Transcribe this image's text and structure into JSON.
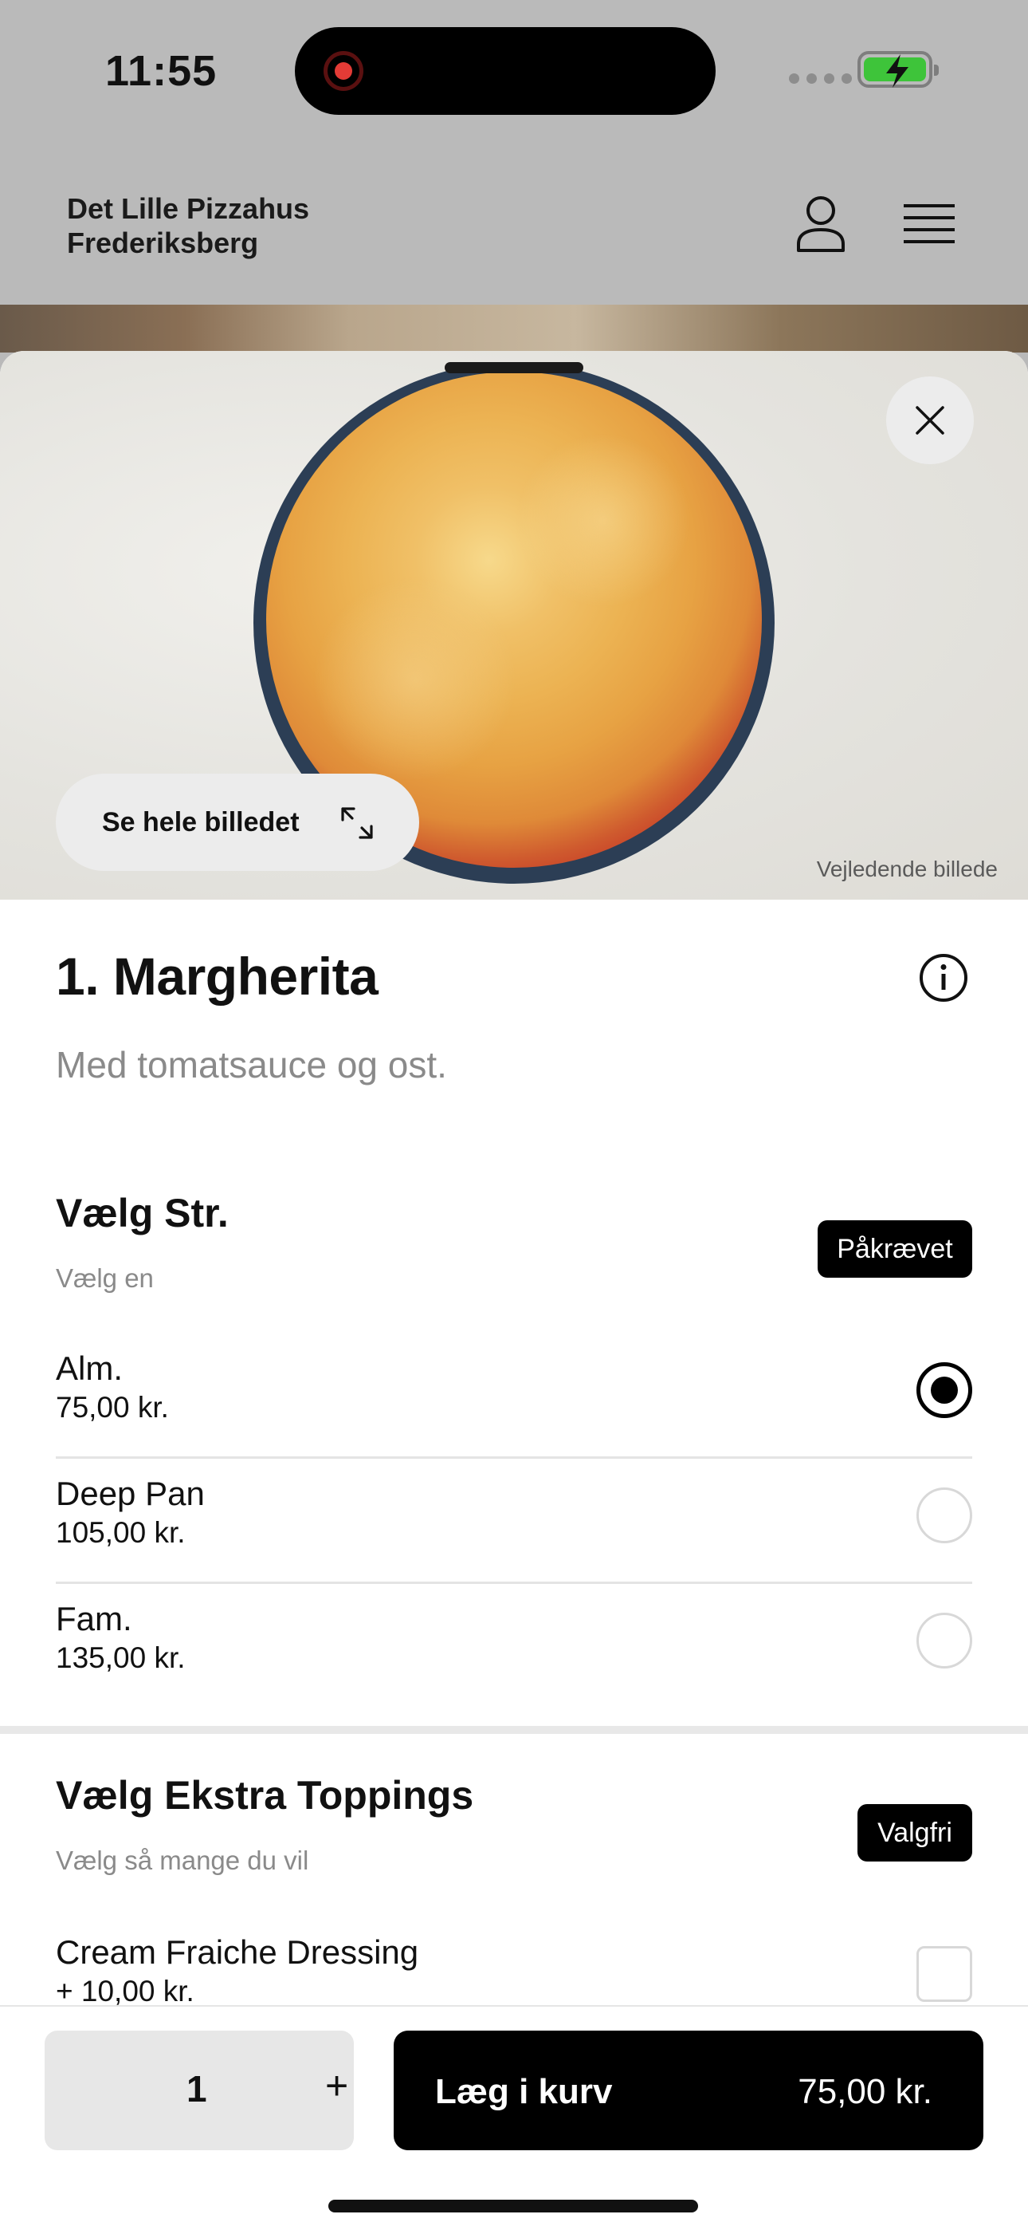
{
  "status_bar": {
    "time": "11:55",
    "battery_color": "#3ec43a"
  },
  "header": {
    "shop_name_line1": "Det Lille Pizzahus",
    "shop_name_line2": "Frederiksberg",
    "user_icon": "user-icon",
    "menu_icon": "hamburger-menu-icon"
  },
  "modal": {
    "close_icon": "close-icon",
    "see_full_image_label": "Se hele billedet",
    "expand_icon": "expand-icon",
    "image_disclaimer": "Vejledende billede"
  },
  "product": {
    "title": "1. Margherita",
    "description": "Med tomatsauce og ost.",
    "info_icon": "info-icon"
  },
  "size_section": {
    "title": "Vælg Str.",
    "subtitle": "Vælg en",
    "badge": "Påkrævet",
    "options": [
      {
        "name": "Alm.",
        "price": "75,00 kr.",
        "selected": true
      },
      {
        "name": "Deep Pan",
        "price": "105,00 kr.",
        "selected": false
      },
      {
        "name": "Fam.",
        "price": "135,00 kr.",
        "selected": false
      }
    ]
  },
  "toppings_section": {
    "title": "Vælg Ekstra Toppings",
    "subtitle": "Vælg så mange du vil",
    "badge": "Valgfri",
    "options": [
      {
        "name": "Cream Fraiche Dressing",
        "price": "+ 10,00 kr.",
        "checked": false
      }
    ]
  },
  "bottom_bar": {
    "quantity": "1",
    "plus_label": "+",
    "add_to_cart_label": "Læg i kurv",
    "total_price": "75,00 kr."
  }
}
